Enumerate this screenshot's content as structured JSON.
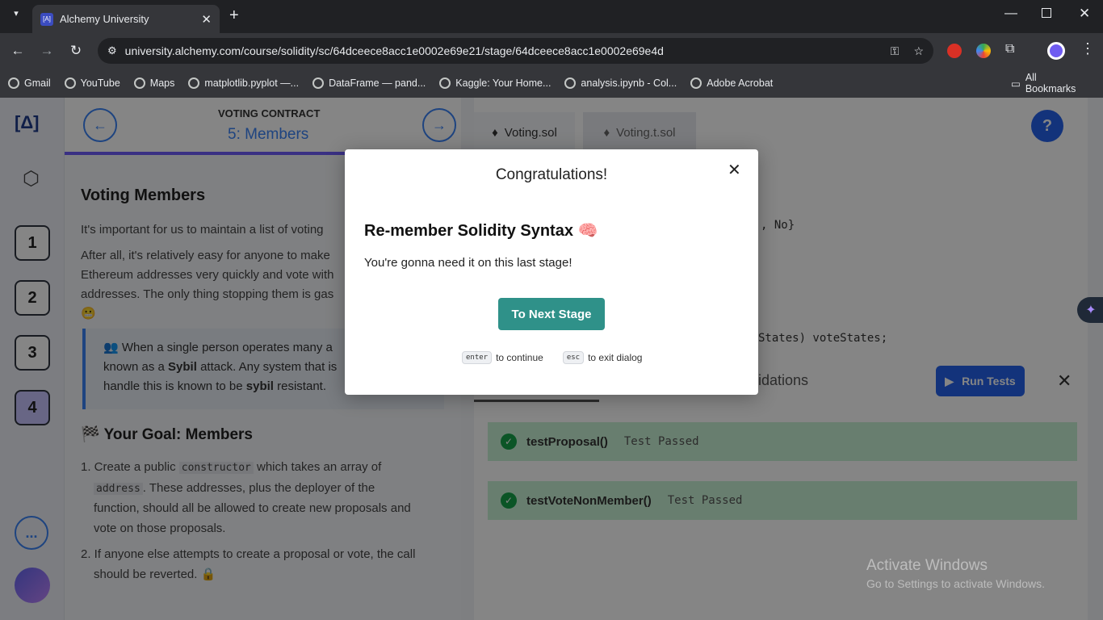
{
  "browser": {
    "tab_title": "Alchemy University",
    "url": "university.alchemy.com/course/solidity/sc/64dceece8acc1e0002e69e21/stage/64dceece8acc1e0002e69e4d",
    "bookmarks": [
      "Gmail",
      "YouTube",
      "Maps",
      "matplotlib.pyplot —...",
      "DataFrame — pand...",
      "Kaggle: Your Home...",
      "analysis.ipynb - Col...",
      "Adobe Acrobat"
    ],
    "all_bookmarks": "All Bookmarks"
  },
  "lesson": {
    "section": "VOTING CONTRACT",
    "stage": "5: Members",
    "title": "Voting Members",
    "p1": "It's important for us to maintain a list of voting",
    "p2": "After all, it's relatively easy for anyone to make",
    "p2b": "Ethereum addresses very quickly and vote with",
    "p2c": "addresses. The only thing stopping them is gas",
    "callout1": "👥 When a single person operates many a",
    "callout2a": "known as a ",
    "callout2b": "Sybil",
    "callout2c": " attack. Any system that is",
    "callout3a": "handle this is known to be ",
    "callout3b": "sybil",
    "callout3c": " resistant.",
    "goal": "🏁 Your Goal: Members",
    "li1a": "1. Create a public ",
    "li1code": "constructor",
    "li1b": " which takes an array of",
    "li1code2": "address",
    "li1c": ". These addresses, plus the deployer of the",
    "li1d": "function, should all be allowed to create new proposals and",
    "li1e": "vote on those proposals.",
    "li2a": "2. If anyone else attempts to create a proposal or vote, the call",
    "li2b": "should be reverted. 🔒"
  },
  "rail": {
    "steps": [
      "1",
      "2",
      "3",
      "4"
    ],
    "more": "..."
  },
  "editor": {
    "tabs": [
      "Voting.sol",
      "Voting.t.sol"
    ],
    "code1": ", No}",
    "code2": "States) voteStates;",
    "validations": "idations",
    "run_tests": "Run Tests"
  },
  "tests": [
    {
      "name": "testProposal()",
      "status": "Test Passed"
    },
    {
      "name": "testVoteNonMember()",
      "status": "Test Passed"
    }
  ],
  "help": "?",
  "watermark": {
    "line1": "Activate Windows",
    "line2": "Go to Settings to activate Windows."
  },
  "modal": {
    "heading": "Congratulations!",
    "title": "Re-member Solidity Syntax 🧠",
    "body": "You're gonna need it on this last stage!",
    "button": "To Next Stage",
    "enter_key": "enter",
    "enter_text": "to continue",
    "esc_key": "esc",
    "esc_text": "to exit dialog"
  }
}
